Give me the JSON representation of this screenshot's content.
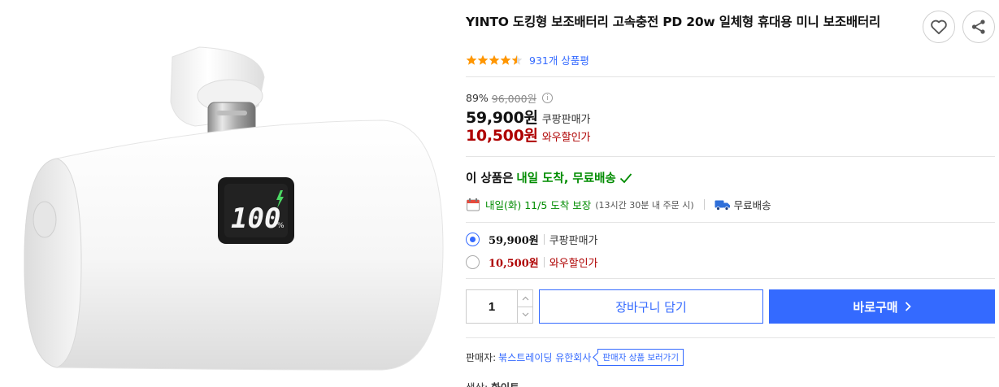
{
  "product": {
    "title": "YINTO 도킹형 보조배터리 고속충전 PD 20w 일체형 휴대용 미니 보조배터리",
    "rating": 4.5,
    "review_count_text": "931개 상품평",
    "battery_display": "100",
    "battery_unit": "%"
  },
  "pricing": {
    "discount_rate": "89%",
    "original_price": "96,000원",
    "coupang_price": "59,900원",
    "coupang_label": "쿠팡판매가",
    "wow_price": "10,500원",
    "wow_label": "와우할인가"
  },
  "delivery": {
    "headline_prefix": "이 상품은",
    "headline_highlight": "내일 도착, 무료배송",
    "date_text": "내일(화) 11/5 도착 보장",
    "order_deadline": "(13시간 30분 내 주문 시)",
    "free_shipping": "무료배송"
  },
  "options": [
    {
      "price": "59,900원",
      "label": "쿠팡판매가",
      "selected": true
    },
    {
      "price": "10,500원",
      "label": "와우할인가",
      "selected": false
    }
  ],
  "purchase": {
    "quantity": "1",
    "cart_label": "장바구니 담기",
    "buy_label": "바로구매"
  },
  "seller": {
    "label": "판매자:",
    "name": "붂스트레이딩 유한회사",
    "link_label": "판매자 상품 보러가기"
  },
  "color_row": {
    "label": "색상:",
    "value": "화이트"
  },
  "colors": {
    "accent_blue": "#346aff",
    "wow_red": "#ae0000",
    "delivery_green": "#008c00",
    "star_orange": "#ff9600"
  }
}
